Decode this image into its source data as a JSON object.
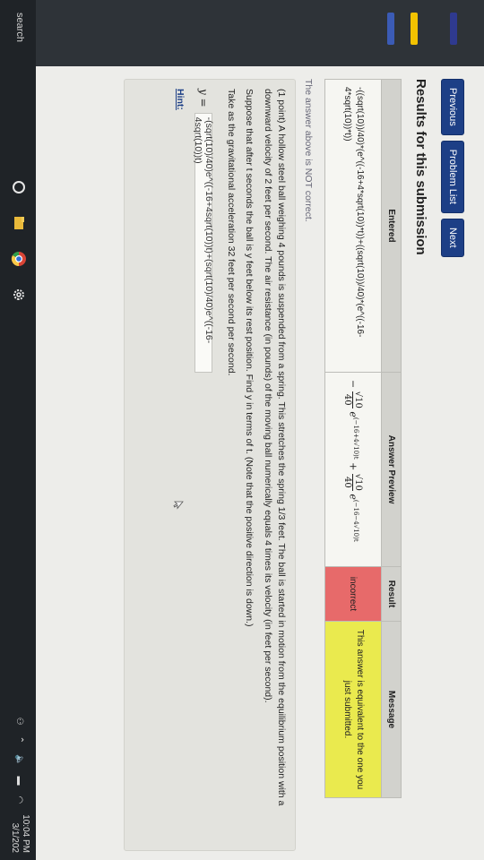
{
  "nav": {
    "previous": "Previous",
    "problem_list": "Problem List",
    "next": "Next"
  },
  "results": {
    "title": "Results for this submission",
    "headers": {
      "entered": "Entered",
      "preview": "Answer Preview",
      "result": "Result",
      "message": "Message"
    },
    "row": {
      "entered": "-((sqrt(10))/40)*(e^((-16+4*sqrt(10))*t))+((sqrt(10))/40)*(e^((-16-4*sqrt(10))*t))",
      "preview_parts": [
        "√10",
        "40",
        "e",
        "(−16+4√10)t",
        "+",
        "√10",
        "40",
        "e",
        "(−16−4√10)t"
      ],
      "result": "incorrect",
      "message": "This answer is equivalent to the one you just submitted."
    }
  },
  "status": {
    "not_correct": "The answer above is NOT correct."
  },
  "problem": {
    "text1": "(1 point) A hollow steel ball weighing 4 pounds is suspended from a spring. This stretches the spring 1/3 feet. The ball is started in motion from the equilibrium position with a downward velocity of 2 feet per second. The air resistance (in pounds) of the moving ball numerically equals 4 times its velocity (in feet per second).",
    "text2": "Suppose that after t seconds the ball is y feet below its rest position. Find y in terms of t. (Note that the positive direction is down.)",
    "text3": "Take as the gravitational acceleration 32 feet per second per second.",
    "y_label": "y =",
    "answer_value": "-(sqrt(10)/40)e^((-16+4sqrt(10))t)+(sqrt(10)/40)e^((-16-4sqrt(10))t)",
    "hint": "Hint:"
  },
  "taskbar": {
    "search": "search",
    "time": "10:04 PM",
    "date": "3/1/202"
  },
  "colors": {
    "nav_button": "#1d3f86",
    "incorrect": "#e76a6a",
    "message_bg": "#eaea4e"
  }
}
